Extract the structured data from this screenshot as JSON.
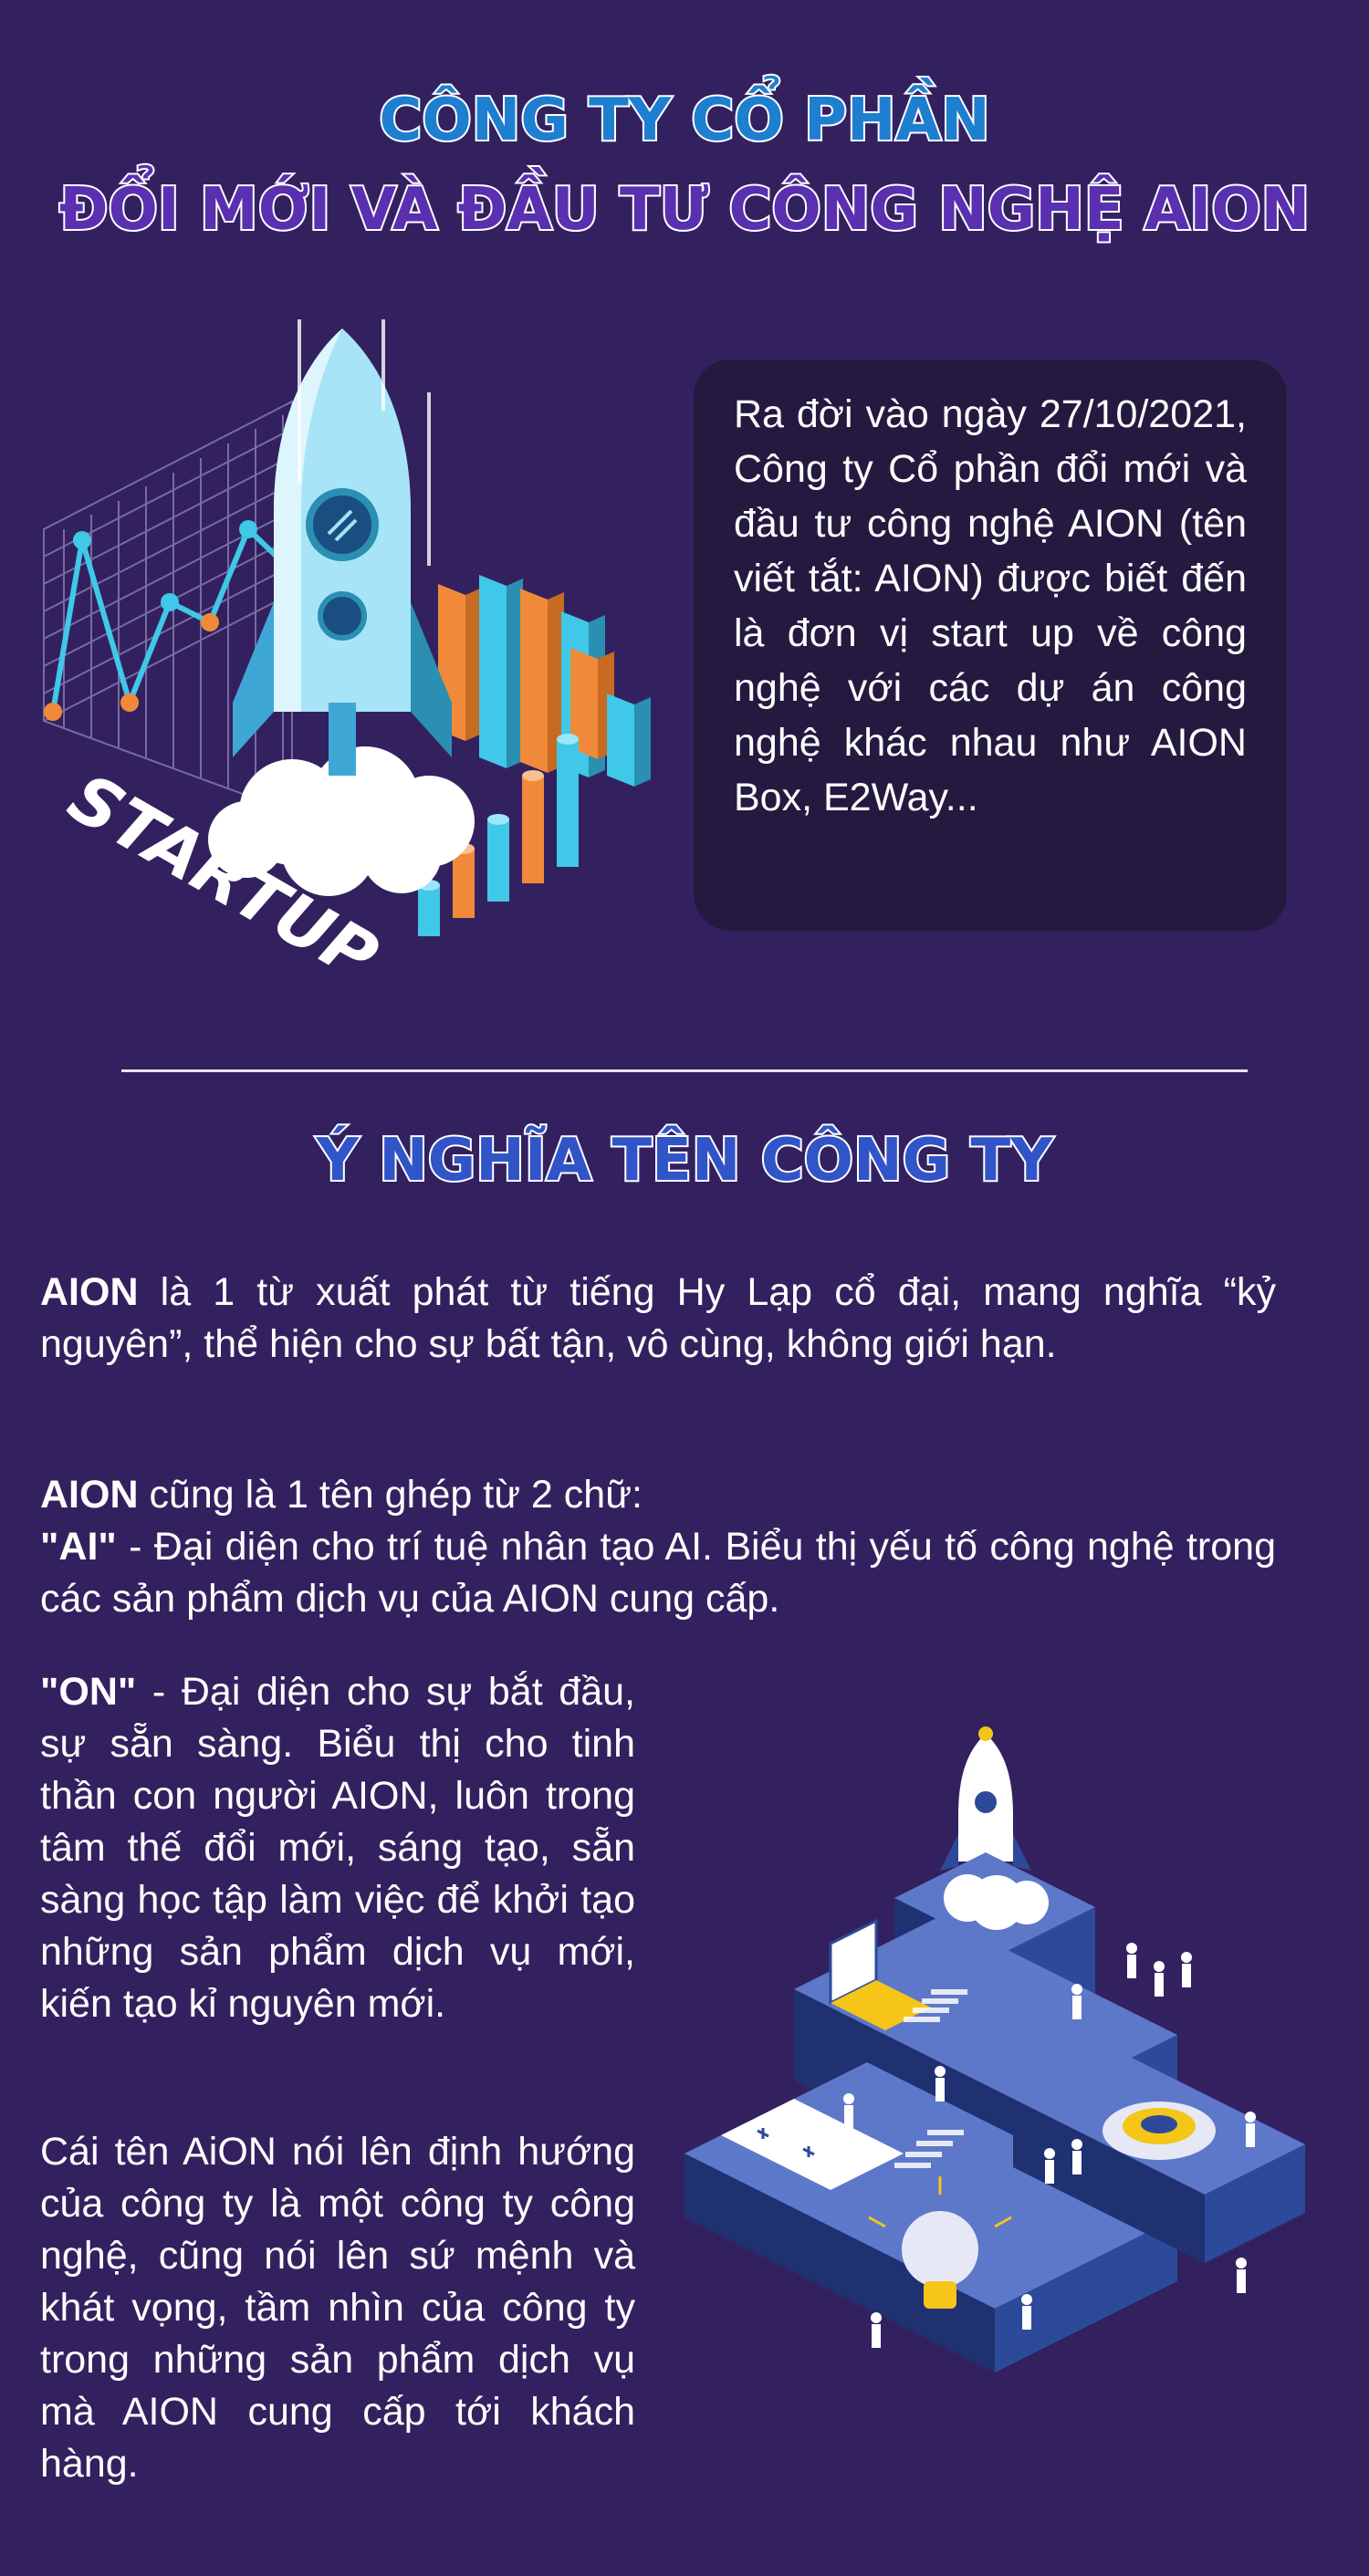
{
  "header": {
    "title_line1": "CÔNG TY CỔ PHẦN",
    "title_line2": "ĐỔI MỚI VÀ ĐẦU TƯ CÔNG NGHỆ AION"
  },
  "intro": {
    "text": "Ra đời vào ngày 27/10/2021, Công ty Cổ phần đổi mới và đầu tư công nghệ AION (tên viết tắt: AION) được biết đến là đơn vị start up về công nghệ với các dự án công nghệ khác nhau như AION Box, E2Way..."
  },
  "startup_illustration": {
    "label": "STARTUP"
  },
  "meaning": {
    "title": "Ý NGHĨA TÊN CÔNG TY",
    "p1_bold": "AION",
    "p1_text": " là 1 từ xuất phát từ tiếng Hy Lạp cổ đại, mang nghĩa “kỷ nguyên”, thể hiện cho sự bất tận, vô cùng, không giới hạn.",
    "p2_bold": "AION",
    "p2_text": " cũng là 1 tên ghép từ 2 chữ:",
    "p2_ai_bold": "\"AI\"",
    "p2_ai_text": " - Đại diện cho trí tuệ nhân tạo AI. Biểu thị yếu tố công nghệ trong các sản phẩm dịch vụ của AION cung cấp.",
    "p3_bold": "\"ON\"",
    "p3_text": " - Đại diện cho sự bắt đầu, sự sẵn sàng. Biểu thị cho tinh thần con người AION, luôn trong tâm thế đổi mới, sáng tạo, sẵn sàng học tập làm việc để khởi tạo những sản phẩm dịch vụ mới, kiến tạo kỉ nguyên mới.",
    "p4_text": "Cái tên AiON nói lên định hướng của công ty là một công ty công nghệ, cũng nói lên sứ mệnh và khát vọng, tầm nhìn của công ty trong những sản phẩm dịch vụ mà AION cung cấp tới khách hàng."
  },
  "colors": {
    "background": "#33215f",
    "box": "#241a40",
    "title_blue": "#1e7fd0",
    "title_purple": "#5a2fb0",
    "accent_cyan": "#3fc8e8",
    "accent_orange": "#f08a3a"
  }
}
